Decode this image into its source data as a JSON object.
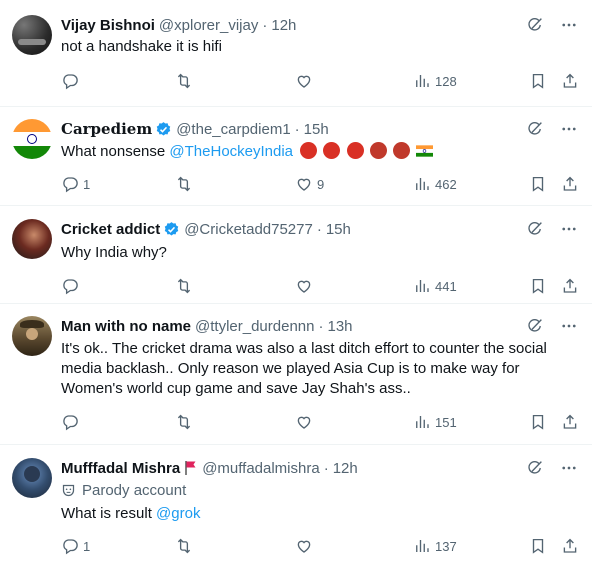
{
  "tweets": [
    {
      "name": "Vijay Bishnoi",
      "handle": "@xplorer_vijay",
      "time": "12h",
      "text": "not a handshake it is hifi",
      "replies": "",
      "likes": "",
      "views": "128"
    },
    {
      "name": "Carpediem",
      "handle": "@the_carpdiem1",
      "time": "15h",
      "text_prefix": "What nonsense ",
      "mention": "@TheHockeyIndia",
      "replies": "1",
      "likes": "9",
      "views": "462"
    },
    {
      "name": "Cricket addict",
      "handle": "@Cricketadd75277",
      "time": "15h",
      "text": "Why India why?",
      "replies": "",
      "likes": "",
      "views": "441"
    },
    {
      "name": "Man with no name",
      "handle": "@ttyler_durdennn",
      "time": "13h",
      "text": "It's ok.. The cricket drama was also a last ditch effort to counter the social media backlash.. Only reason we played Asia Cup is to make way for Women's world cup game and save Jay Shah's ass..",
      "replies": "",
      "likes": "",
      "views": "151"
    },
    {
      "name": "Mufffadal Mishra",
      "handle": "@muffadalmishra",
      "time": "12h",
      "parody": "Parody account",
      "text_prefix": "What is result ",
      "mention": "@grok",
      "replies": "1",
      "likes": "",
      "views": "137"
    }
  ],
  "icons": {
    "grok": "grok-icon",
    "more": "more-icon",
    "reply": "reply-icon",
    "retweet": "retweet-icon",
    "like": "like-icon",
    "views": "views-icon",
    "bookmark": "bookmark-icon",
    "share": "share-icon"
  },
  "colors": {
    "text": "#0f1419",
    "muted": "#536471",
    "link": "#1d9bf0",
    "border": "#eff3f4"
  }
}
